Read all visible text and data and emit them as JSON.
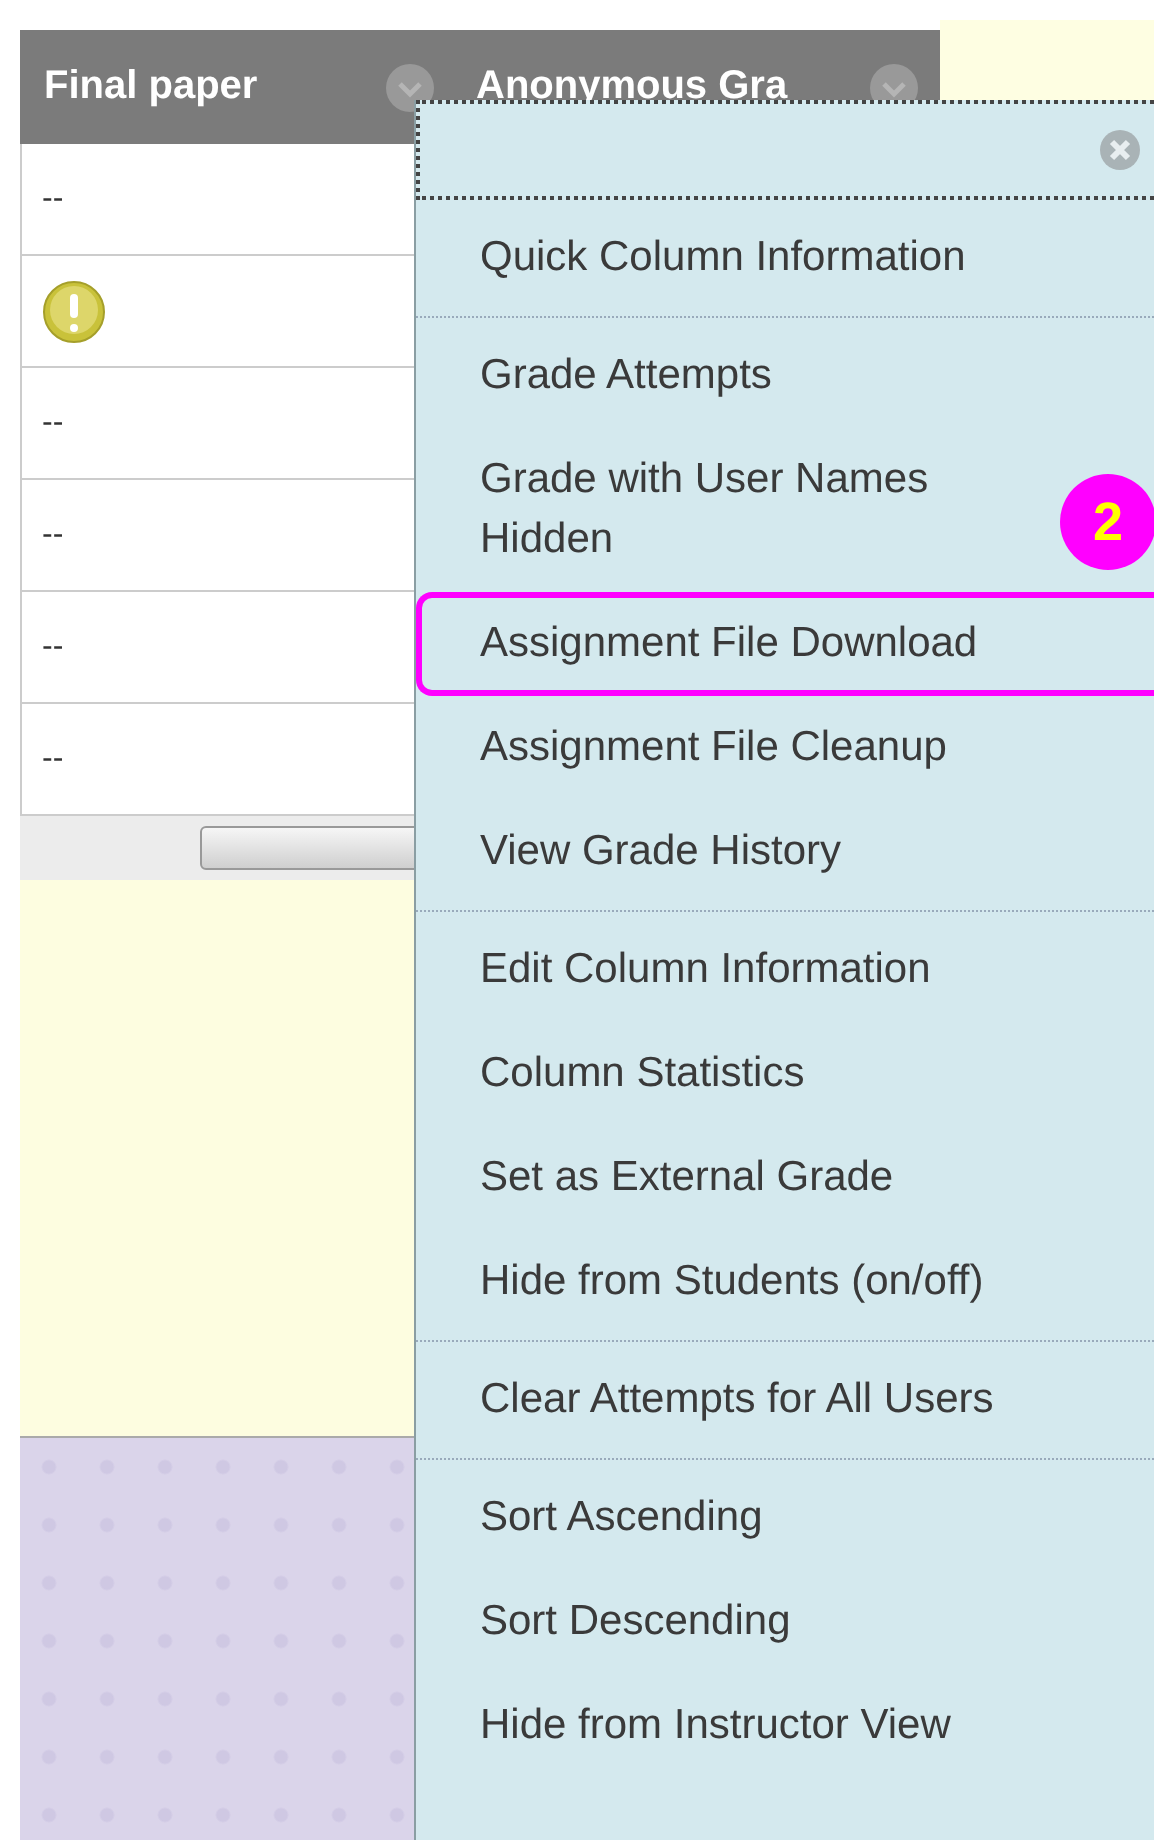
{
  "table": {
    "columns": [
      {
        "label": "Final paper"
      },
      {
        "label": "Anonymous Gra"
      }
    ],
    "rows": [
      {
        "kind": "text",
        "value": "--"
      },
      {
        "kind": "alert"
      },
      {
        "kind": "text",
        "value": "--"
      },
      {
        "kind": "text",
        "value": "--"
      },
      {
        "kind": "text",
        "value": "--"
      },
      {
        "kind": "text",
        "value": "--"
      }
    ]
  },
  "menu": {
    "groups": [
      {
        "items": [
          {
            "label": "Quick Column Information",
            "highlighted": false
          }
        ]
      },
      {
        "items": [
          {
            "label": "Grade Attempts",
            "highlighted": false
          },
          {
            "label": "Grade with User Names Hidden",
            "highlighted": false
          },
          {
            "label": "Assignment File Download",
            "highlighted": true
          },
          {
            "label": "Assignment File Cleanup",
            "highlighted": false
          },
          {
            "label": "View Grade History",
            "highlighted": false
          }
        ]
      },
      {
        "items": [
          {
            "label": "Edit Column Information",
            "highlighted": false
          },
          {
            "label": "Column Statistics",
            "highlighted": false
          },
          {
            "label": "Set as External Grade",
            "highlighted": false
          },
          {
            "label": "Hide from Students (on/off)",
            "highlighted": false
          }
        ]
      },
      {
        "items": [
          {
            "label": "Clear Attempts for All Users",
            "highlighted": false
          }
        ]
      },
      {
        "items": [
          {
            "label": "Sort Ascending",
            "highlighted": false
          },
          {
            "label": "Sort Descending",
            "highlighted": false
          },
          {
            "label": "Hide from Instructor View",
            "highlighted": false
          }
        ]
      }
    ]
  },
  "callout": {
    "number": "2"
  }
}
